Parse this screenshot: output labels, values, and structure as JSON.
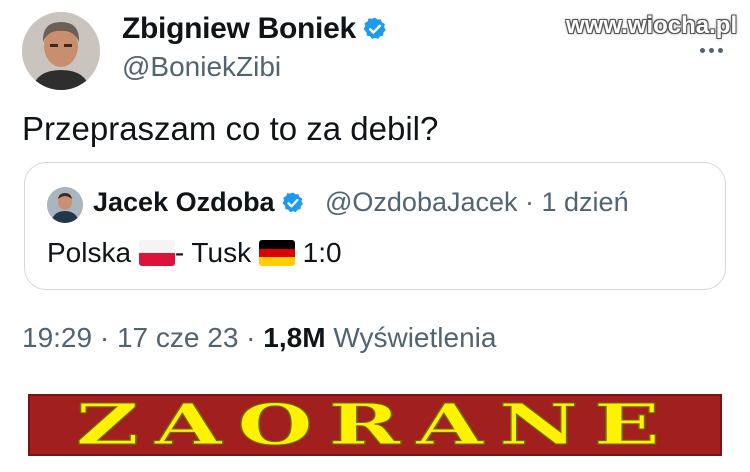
{
  "tweet": {
    "author_name": "Zbigniew Boniek",
    "author_handle": "@BoniekZibi",
    "text": "Przepraszam co to za debil?",
    "time": "19:29",
    "date": "17 cze 23",
    "views_count": "1,8M",
    "views_label": "Wyświetlenia"
  },
  "quoted": {
    "author_name": "Jacek Ozdoba",
    "author_handle": "@OzdobaJacek",
    "age": "1 dzień",
    "text_part1": "Polska",
    "text_part2": "- Tusk",
    "text_part3": "1:0"
  },
  "watermark": "www.wiocha.pl",
  "banner_text": "ZAORANE",
  "colors": {
    "verified": "#1d9bf0",
    "banner_bg": "#a11f1f",
    "banner_text": "#fff200",
    "secondary_text": "#536471"
  },
  "icons": [
    "verified-badge-icon",
    "more-options-icon",
    "poland-flag-icon",
    "germany-flag-icon"
  ]
}
